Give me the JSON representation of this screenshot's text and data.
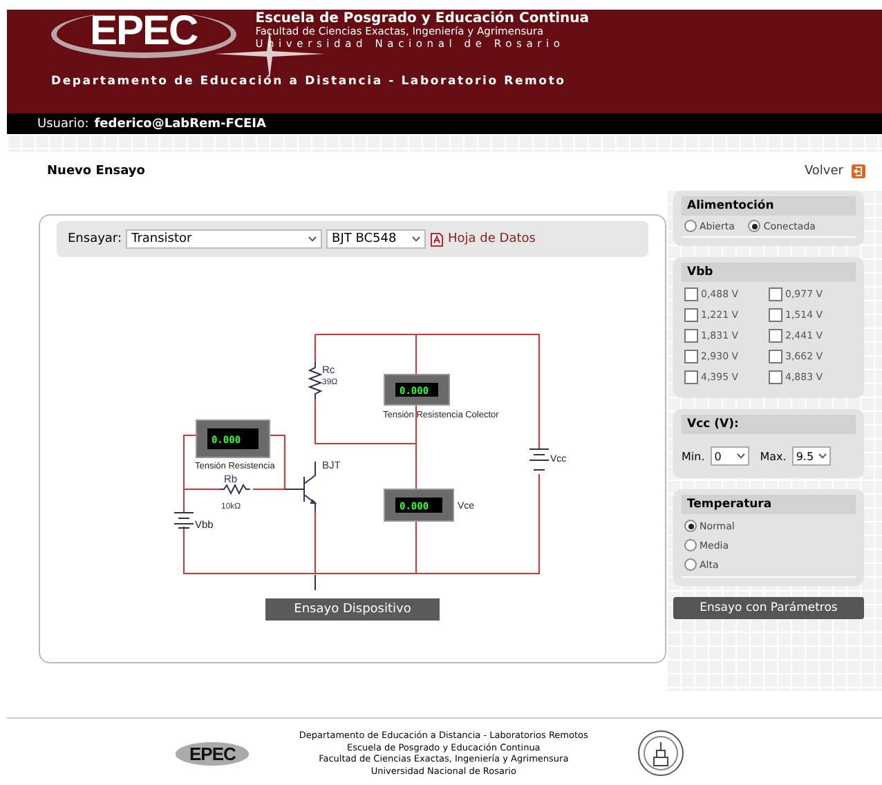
{
  "header": {
    "logo": "EPEC",
    "title_lines": [
      "Escuela de Posgrado y Educación Continua",
      "Facultad de Ciencias Exactas, Ingeniería y Agrimensura",
      "Universidad Nacional de Rosario"
    ],
    "department": "Departamento de Educación a Distancia - Laboratorio Remoto"
  },
  "user_bar": {
    "label": "Usuario:",
    "user": "federico@LabRem-FCEIA"
  },
  "page_title": "Nuevo Ensayo",
  "back_link": "Volver",
  "test_bar": {
    "label": "Ensayar:",
    "device_select": "Transistor",
    "model_select": "BJT BC548",
    "datasheet_link": "Hoja de Datos"
  },
  "circuit": {
    "rc_name": "Rc",
    "rc_value": "39Ω",
    "rb_name": "Rb",
    "rb_value": "10kΩ",
    "transistor": "BJT",
    "vbb": "Vbb",
    "vcc": "Vcc",
    "meters": [
      {
        "reading": "0.000",
        "caption": "Tensión Resistencia"
      },
      {
        "reading": "0.000",
        "caption": "Tensión Resistencia Colector"
      },
      {
        "reading": "0.000",
        "caption": "Vce"
      }
    ]
  },
  "run_button": "Ensayo Dispositivo",
  "power": {
    "title": "Alimentoción",
    "options": [
      {
        "label": "Abierta",
        "selected": false
      },
      {
        "label": "Conectada",
        "selected": true
      }
    ]
  },
  "vbb": {
    "title": "Vbb",
    "options": [
      {
        "label": "0,488 V",
        "checked": false
      },
      {
        "label": "0,977 V",
        "checked": false
      },
      {
        "label": "1,221 V",
        "checked": false
      },
      {
        "label": "1,514 V",
        "checked": false
      },
      {
        "label": "1,831 V",
        "checked": false
      },
      {
        "label": "2,441 V",
        "checked": false
      },
      {
        "label": "2,930 V",
        "checked": false
      },
      {
        "label": "3,662 V",
        "checked": false
      },
      {
        "label": "4,395 V",
        "checked": false
      },
      {
        "label": "4,883 V",
        "checked": false
      }
    ]
  },
  "vcc": {
    "title": "Vcc (V):",
    "min_label": "Min.",
    "min_value": "0",
    "max_label": "Max.",
    "max_value": "9.5"
  },
  "temperature": {
    "title": "Temperatura",
    "options": [
      {
        "label": "Normal",
        "selected": true
      },
      {
        "label": "Media",
        "selected": false
      },
      {
        "label": "Alta",
        "selected": false
      }
    ]
  },
  "params_button": "Ensayo con Parámetros",
  "footer": {
    "logo": "EPEC",
    "lines": [
      "Departamento de Educación a Distancia - Laboratorios Remotos",
      "Escuela de Posgrado y Educación Continua",
      "Facultad de Ciencias Exactas, Ingeniería y Agrimensura",
      "Universidad Nacional de Rosario"
    ]
  }
}
